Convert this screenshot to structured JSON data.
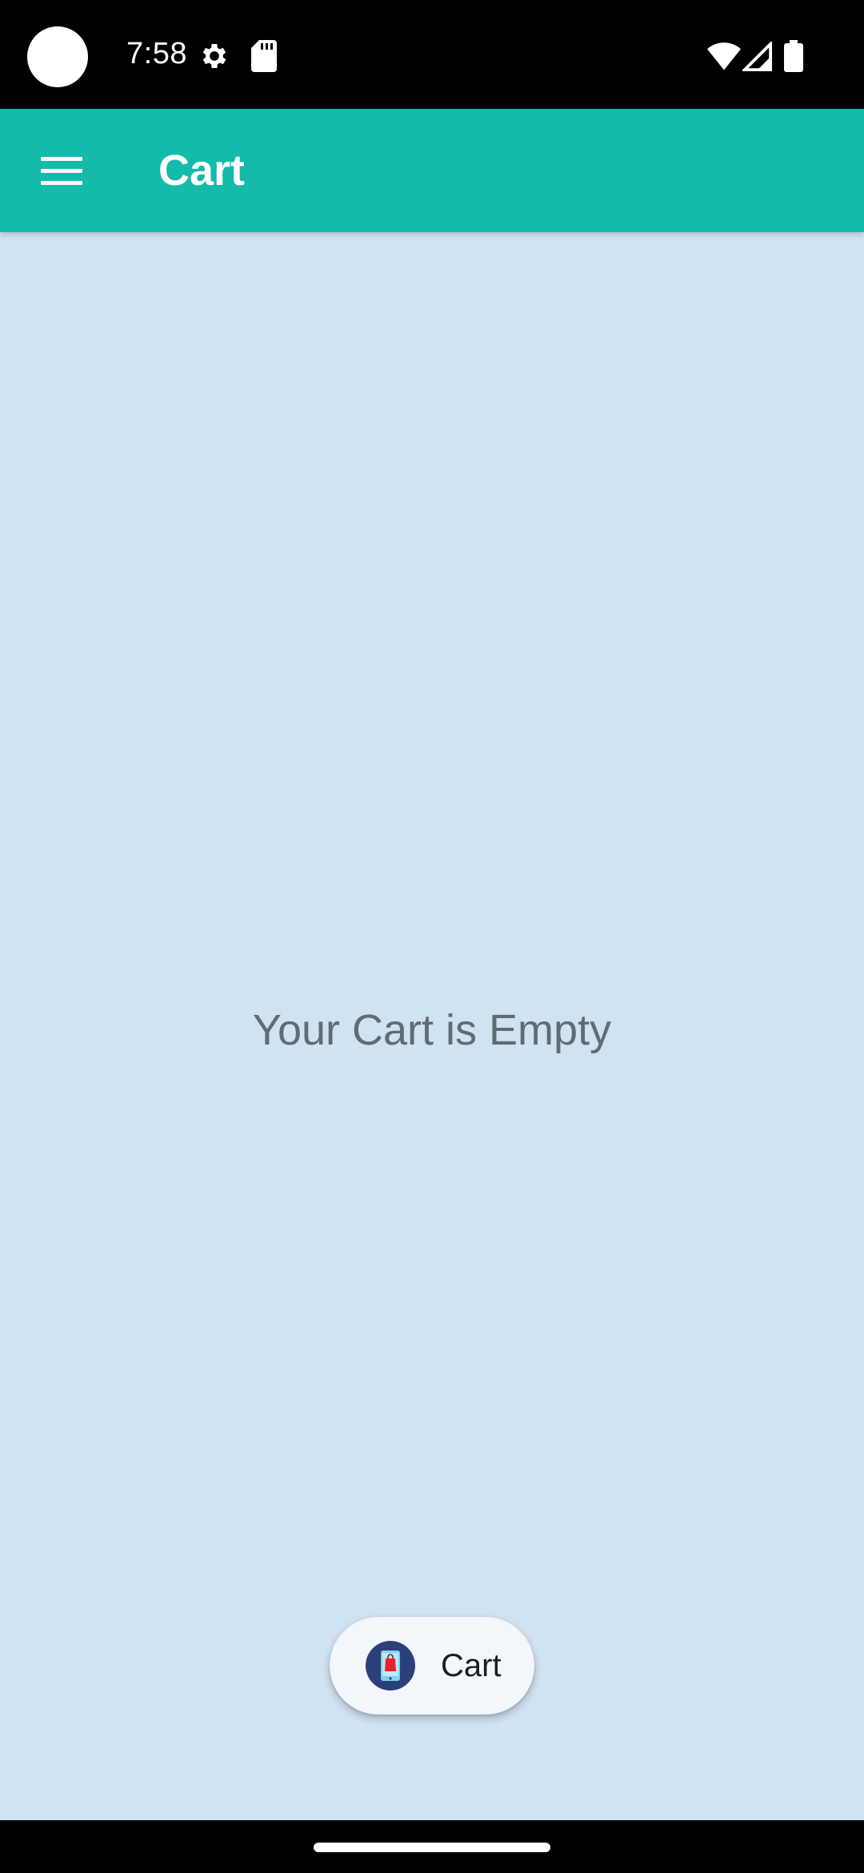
{
  "status_bar": {
    "time": "7:58",
    "icons": [
      "settings-gear-icon",
      "sd-card-icon",
      "wifi-icon",
      "cellular-signal-icon",
      "battery-icon"
    ]
  },
  "app_bar": {
    "title": "Cart",
    "menu_icon": "hamburger-menu-icon",
    "color": "#14bbab"
  },
  "content": {
    "empty_message": "Your Cart is Empty",
    "background": "#d0e3f3"
  },
  "fab": {
    "label": "Cart",
    "icon": "shopping-bag-phone-icon"
  }
}
